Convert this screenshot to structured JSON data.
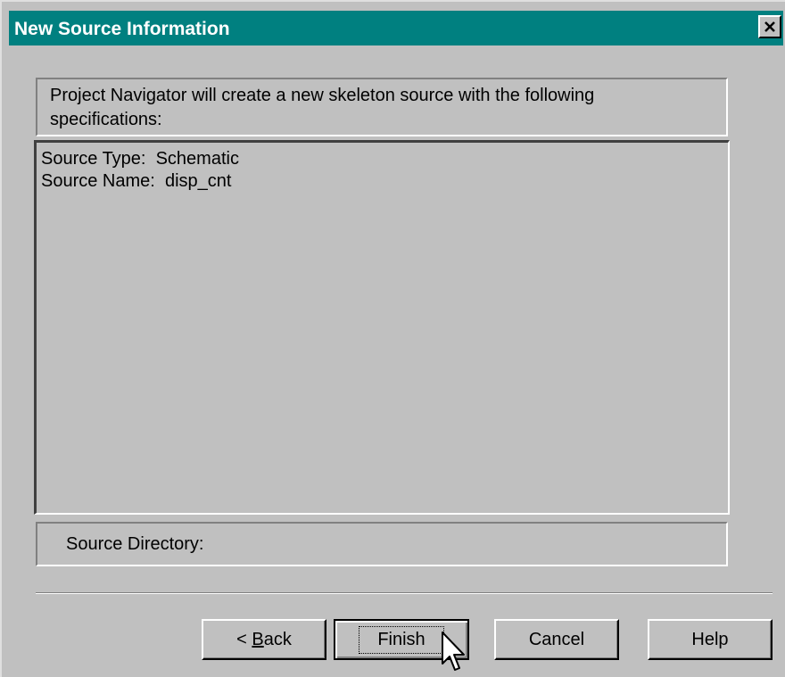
{
  "window": {
    "title": "New Source Information",
    "close_glyph": "✕"
  },
  "header": {
    "text": "Project Navigator will create a new skeleton source with the following specifications:"
  },
  "specifications": {
    "line1": "Source Type:  Schematic",
    "line2": "Source Name:  disp_cnt"
  },
  "source_directory": {
    "label": "Source Directory:"
  },
  "buttons": {
    "back_prefix": "< ",
    "back_mnemonic": "B",
    "back_rest": "ack",
    "finish": "Finish",
    "cancel": "Cancel",
    "help": "Help"
  },
  "icons": {
    "close": "close-icon",
    "cursor": "mouse-pointer-icon"
  },
  "colors": {
    "titlebar": "#008080",
    "face": "#c0c0c0"
  }
}
